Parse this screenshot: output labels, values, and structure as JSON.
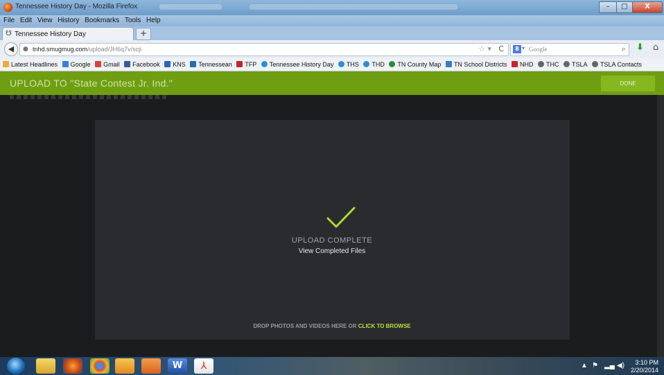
{
  "window": {
    "title": "Tennessee History Day - Mozilla Firefox",
    "controls": {
      "minimize": "–",
      "maximize": "□",
      "close": "X"
    }
  },
  "menu": [
    "File",
    "Edit",
    "View",
    "History",
    "Bookmarks",
    "Tools",
    "Help"
  ],
  "tab": {
    "title": "Tennessee History Day",
    "new_tab": "+"
  },
  "nav": {
    "url_domain": "tnhd.smugmug.com",
    "url_path": "/upload/JH6q7v/scji",
    "search_placeholder": "Google"
  },
  "bookmarks": [
    {
      "label": "Latest Headlines",
      "color": "#f2a93b"
    },
    {
      "label": "Google",
      "color": "#3b7ddd"
    },
    {
      "label": "Gmail",
      "color": "#d44638"
    },
    {
      "label": "Facebook",
      "color": "#3b5998"
    },
    {
      "label": "KNS",
      "color": "#2a66b5"
    },
    {
      "label": "Tennessean",
      "color": "#1f6fb3"
    },
    {
      "label": "TFP",
      "color": "#c0272d"
    },
    {
      "label": "Tennessee History Day",
      "color": "#2b8fd6"
    },
    {
      "label": "THS",
      "color": "#2b8fd6"
    },
    {
      "label": "THD",
      "color": "#2b8fd6"
    },
    {
      "label": "TN County Map",
      "color": "#2a8a3a"
    },
    {
      "label": "TN School Districts",
      "color": "#3a7bc8"
    },
    {
      "label": "NHD",
      "color": "#c3262f"
    },
    {
      "label": "THC",
      "color": "#666666"
    },
    {
      "label": "TSLA",
      "color": "#666666"
    },
    {
      "label": "TSLA Contacts",
      "color": "#666666"
    }
  ],
  "header": {
    "title": "UPLOAD TO  \"State Contest Jr. Ind.\"",
    "done_label": "DONE",
    "bg_color": "#6f9e13"
  },
  "upload": {
    "status": "UPLOAD COMPLETE",
    "view_link": "View Completed Files",
    "drop_hint": "DROP PHOTOS AND VIDEOS HERE OR ",
    "browse_link": "CLICK TO BROWSE",
    "accent": "#b6e33a"
  },
  "taskbar": {
    "apps": [
      "windows-explorer",
      "firefox",
      "chrome",
      "outlook",
      "media-player",
      "word",
      "acrobat"
    ],
    "time": "3:10 PM",
    "date": "2/20/2014"
  }
}
